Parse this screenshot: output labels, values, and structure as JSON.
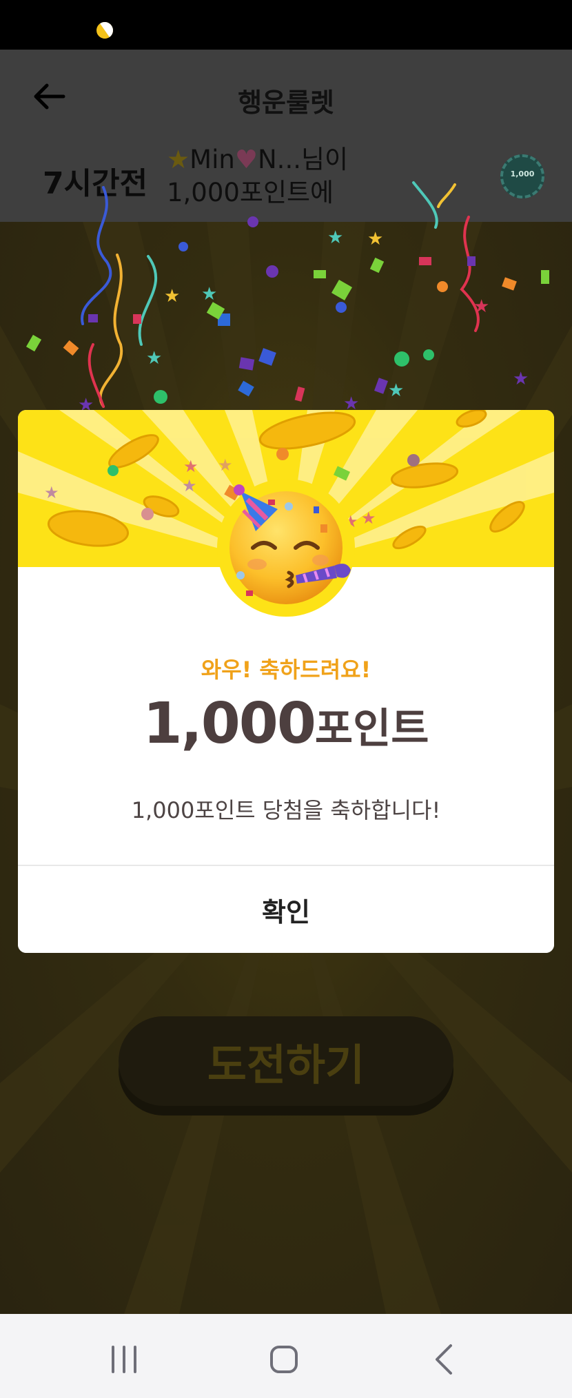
{
  "app": {
    "title": "행운룰렛"
  },
  "recent_winner": {
    "time": "7시간전",
    "line1_star": "★",
    "line1_name_a": "Min",
    "line1_heart": "♥",
    "line1_name_b": "N...님이",
    "line2": "1,000포인트에",
    "chip_label": "1,000"
  },
  "dialog": {
    "subtitle": "와우! 축하드려요!",
    "amount_number": "1,000",
    "amount_unit": "포인트",
    "description": "1,000포인트 당첨을 축하합니다!",
    "confirm_label": "확인"
  },
  "challenge_button": {
    "label": "도전하기"
  },
  "nav": {
    "recents_icon": "recents-icon",
    "home_icon": "home-icon",
    "back_icon": "back-icon"
  },
  "colors": {
    "accent_yellow": "#fde217",
    "subtitle_orange": "#f0a21a",
    "amount_text": "#4d3f3f"
  }
}
